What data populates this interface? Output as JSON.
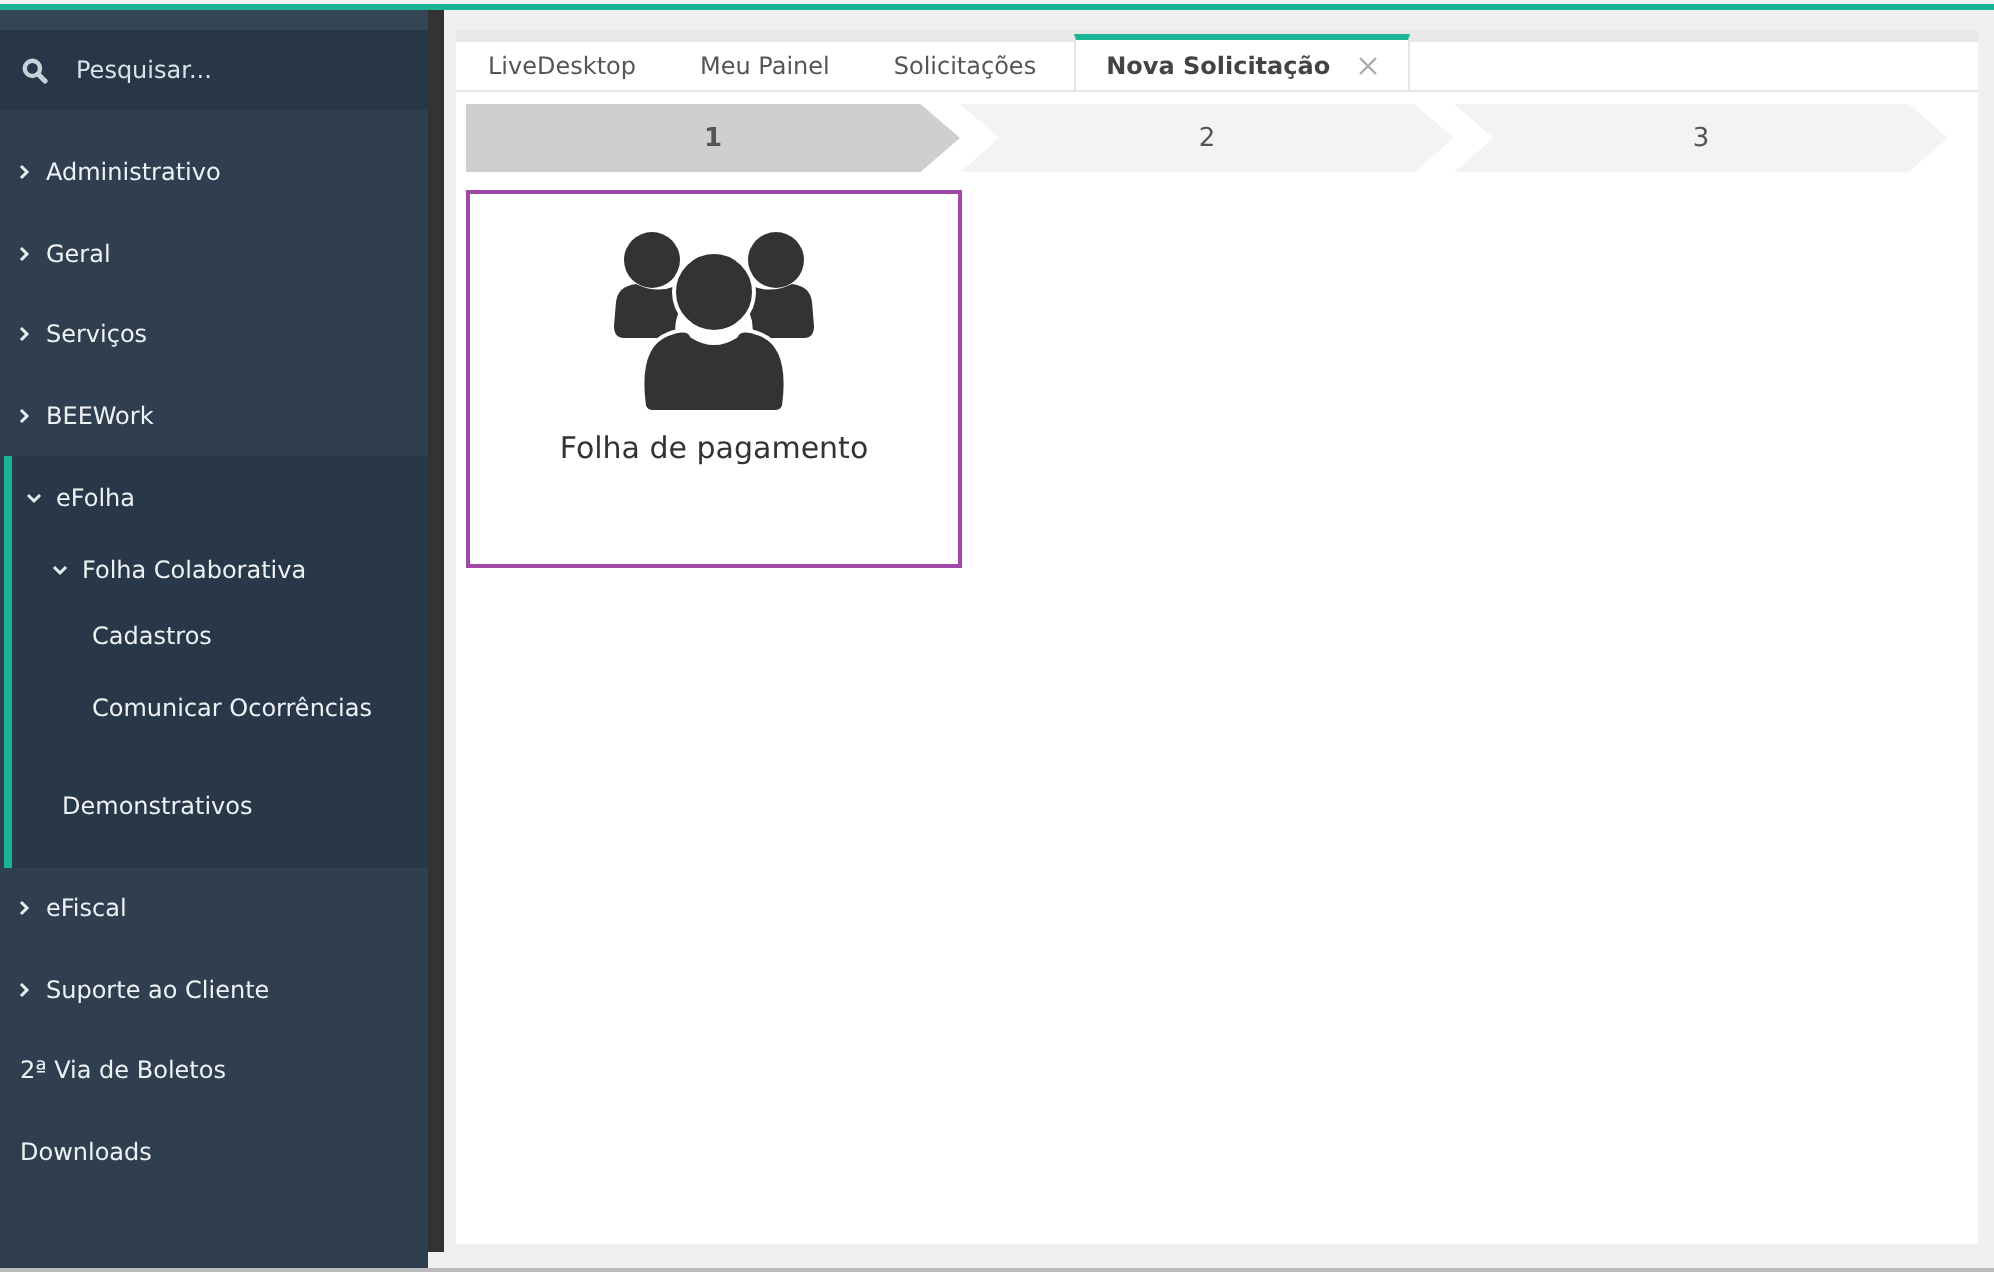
{
  "sidebar": {
    "search": {
      "placeholder": "Pesquisar..."
    },
    "menu": [
      {
        "label": "Administrativo",
        "kind": "group",
        "expanded": false
      },
      {
        "label": "Geral",
        "kind": "group",
        "expanded": false
      },
      {
        "label": "Serviços",
        "kind": "group",
        "expanded": false
      },
      {
        "label": "BEEWork",
        "kind": "group",
        "expanded": false
      },
      {
        "label": "eFolha",
        "kind": "group",
        "expanded": true,
        "children": [
          {
            "label": "Folha Colaborativa",
            "kind": "group",
            "expanded": true,
            "children": [
              {
                "label": "Cadastros",
                "kind": "link"
              },
              {
                "label": "Comunicar Ocorrências",
                "kind": "link"
              }
            ]
          },
          {
            "label": "Demonstrativos",
            "kind": "link"
          }
        ]
      },
      {
        "label": "eFiscal",
        "kind": "group",
        "expanded": false
      },
      {
        "label": "Suporte ao Cliente",
        "kind": "group",
        "expanded": false
      },
      {
        "label": "2ª Via de Boletos",
        "kind": "link"
      },
      {
        "label": "Downloads",
        "kind": "link"
      }
    ]
  },
  "tabs": [
    {
      "label": "LiveDesktop",
      "selected": false,
      "closable": false
    },
    {
      "label": "Meu Painel",
      "selected": false,
      "closable": false
    },
    {
      "label": "Solicitações",
      "selected": false,
      "closable": false
    },
    {
      "label": "Nova Solicitação",
      "selected": true,
      "closable": true
    }
  ],
  "steps": [
    {
      "label": "1",
      "selected": true
    },
    {
      "label": "2",
      "selected": false
    },
    {
      "label": "3",
      "selected": false
    }
  ],
  "cards": [
    {
      "label": "Folha de pagamento",
      "selected": true
    }
  ]
}
